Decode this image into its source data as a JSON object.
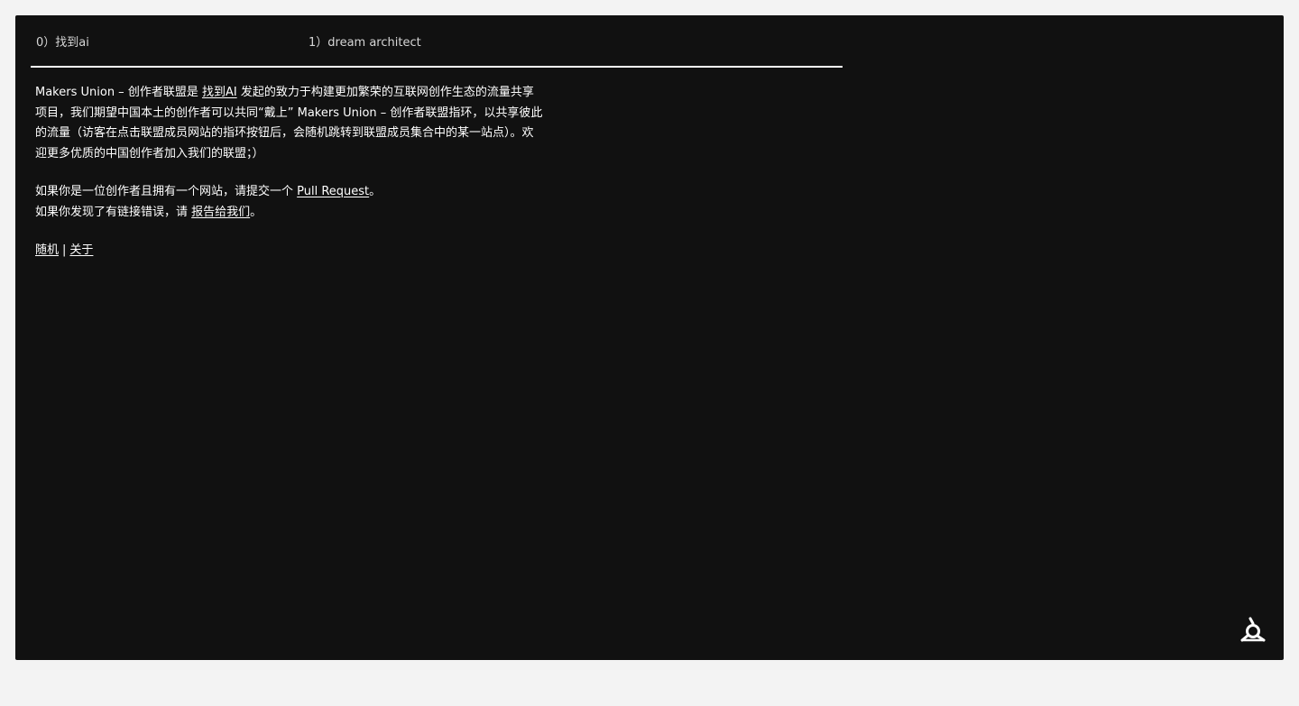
{
  "members": [
    {
      "label": "0）找到ai"
    },
    {
      "label": "1）dream architect"
    }
  ],
  "intro": {
    "before_link": "Makers Union – 创作者联盟是 ",
    "link": "找到AI",
    "after_link": " 发起的致力于构建更加繁荣的互联网创作生态的流量共享项目，我们期望中国本土的创作者可以共同“戴上” Makers Union – 创作者联盟指环，以共享彼此的流量（访客在点击联盟成员网站的指环按钮后，会随机跳转到联盟成员集合中的某一站点）。欢迎更多优质的中国创作者加入我们的联盟；）"
  },
  "submit": {
    "before_link": "如果你是一位创作者且拥有一个网站，请提交一个 ",
    "link": "Pull Request",
    "after_link": "。"
  },
  "report": {
    "before_link": "如果你发现了有链接错误，请 ",
    "link": "报告给我们",
    "after_link": "。"
  },
  "footer_links": {
    "random": "随机",
    "separator": "|",
    "about": "关于"
  },
  "logo_icon": "makers-union-ring-logo"
}
